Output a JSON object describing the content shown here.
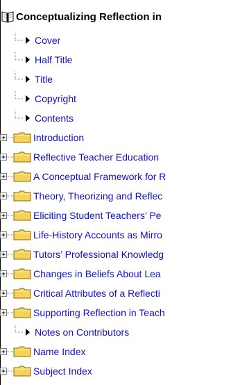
{
  "tree": {
    "root": {
      "title": "Conceptualizing Reflection in",
      "icon": "book-icon"
    },
    "items": [
      {
        "type": "page",
        "label": "Cover"
      },
      {
        "type": "page",
        "label": "Half Title"
      },
      {
        "type": "page",
        "label": "Title"
      },
      {
        "type": "page",
        "label": "Copyright"
      },
      {
        "type": "page",
        "label": "Contents"
      },
      {
        "type": "folder",
        "label": "Introduction"
      },
      {
        "type": "folder",
        "label": "Reflective Teacher Education"
      },
      {
        "type": "folder",
        "label": "A Conceptual Framework for R"
      },
      {
        "type": "folder",
        "label": "Theory, Theorizing and Reflec"
      },
      {
        "type": "folder",
        "label": "Eliciting Student Teachers’ Pe"
      },
      {
        "type": "folder",
        "label": "Life-History Accounts as Mirro"
      },
      {
        "type": "folder",
        "label": "Tutors’ Professional Knowledg"
      },
      {
        "type": "folder",
        "label": "Changes in Beliefs About Lea"
      },
      {
        "type": "folder",
        "label": "Critical Attributes of a Reflecti"
      },
      {
        "type": "folder",
        "label": "Supporting Reflection in Teach"
      },
      {
        "type": "page",
        "label": "Notes on Contributors"
      },
      {
        "type": "folder",
        "label": "Name Index"
      },
      {
        "type": "folder",
        "label": "Subject Index"
      }
    ]
  },
  "colors": {
    "link": "#1010c8",
    "folder": "#f5d35a",
    "connector": "#7f7f7f"
  }
}
